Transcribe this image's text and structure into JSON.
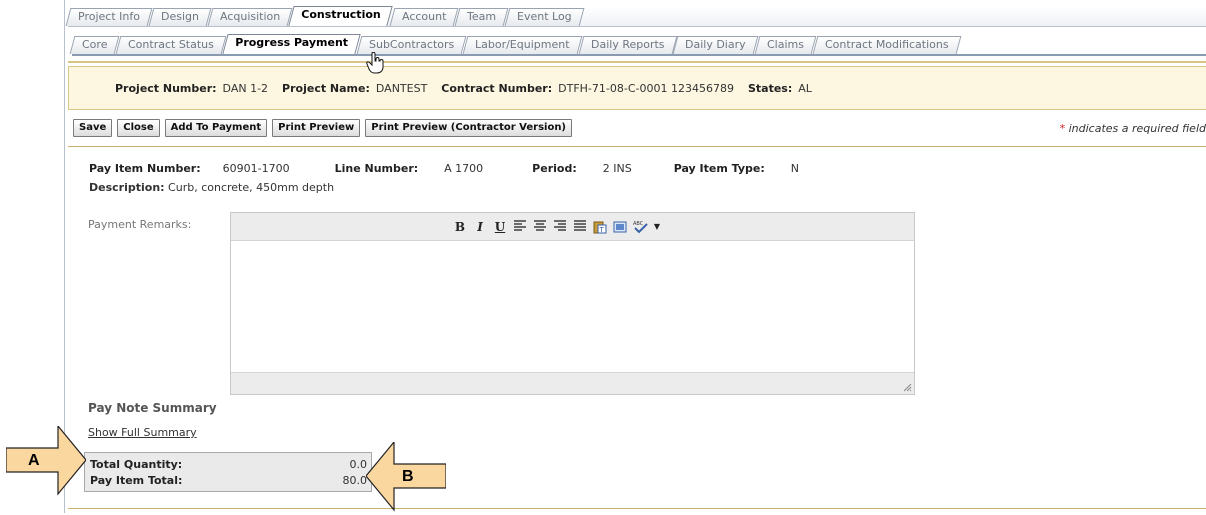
{
  "tabs_primary": [
    {
      "label": "Project Info",
      "active": false
    },
    {
      "label": "Design",
      "active": false
    },
    {
      "label": "Acquisition",
      "active": false
    },
    {
      "label": "Construction",
      "active": true
    },
    {
      "label": "Account",
      "active": false
    },
    {
      "label": "Team",
      "active": false
    },
    {
      "label": "Event Log",
      "active": false
    }
  ],
  "tabs_secondary": [
    {
      "label": "Core",
      "active": false
    },
    {
      "label": "Contract Status",
      "active": false
    },
    {
      "label": "Progress Payment",
      "active": true
    },
    {
      "label": "SubContractors",
      "active": false
    },
    {
      "label": "Labor/Equipment",
      "active": false
    },
    {
      "label": "Daily Reports",
      "active": false
    },
    {
      "label": "Daily Diary",
      "active": false
    },
    {
      "label": "Claims",
      "active": false
    },
    {
      "label": "Contract Modifications",
      "active": false
    }
  ],
  "project": {
    "number_label": "Project Number:",
    "number": "DAN 1-2",
    "name_label": "Project Name:",
    "name": "DANTEST",
    "contract_label": "Contract Number:",
    "contract": "DTFH-71-08-C-0001 123456789",
    "states_label": "States:",
    "states": "AL"
  },
  "toolbar": {
    "save": "Save",
    "close": "Close",
    "add_to_payment": "Add To Payment",
    "print_preview": "Print Preview",
    "print_preview_contractor": "Print Preview (Contractor Version)"
  },
  "required_note": {
    "star": "*",
    "text": " indicates a required field"
  },
  "pay_item": {
    "number_label": "Pay Item Number:",
    "number": "60901-1700",
    "line_label": "Line Number:",
    "line": "A 1700",
    "period_label": "Period:",
    "period": "2 INS",
    "type_label": "Pay Item Type:",
    "type": "N",
    "description_label": "Description:",
    "description": "Curb, concrete, 450mm depth"
  },
  "remarks": {
    "label": "Payment Remarks:",
    "value": ""
  },
  "pay_note": {
    "title": "Pay Note Summary",
    "show_full": "Show Full Summary",
    "total_quantity_label": "Total Quantity:",
    "total_quantity": "0.0",
    "pay_item_total_label": "Pay Item Total:",
    "pay_item_total": "80.0"
  },
  "callouts": {
    "a": "A",
    "b": "B"
  },
  "colors": {
    "callout_fill": "#fbd7a0",
    "project_bar": "#fdf7e1",
    "rule": "#c9b06b"
  }
}
